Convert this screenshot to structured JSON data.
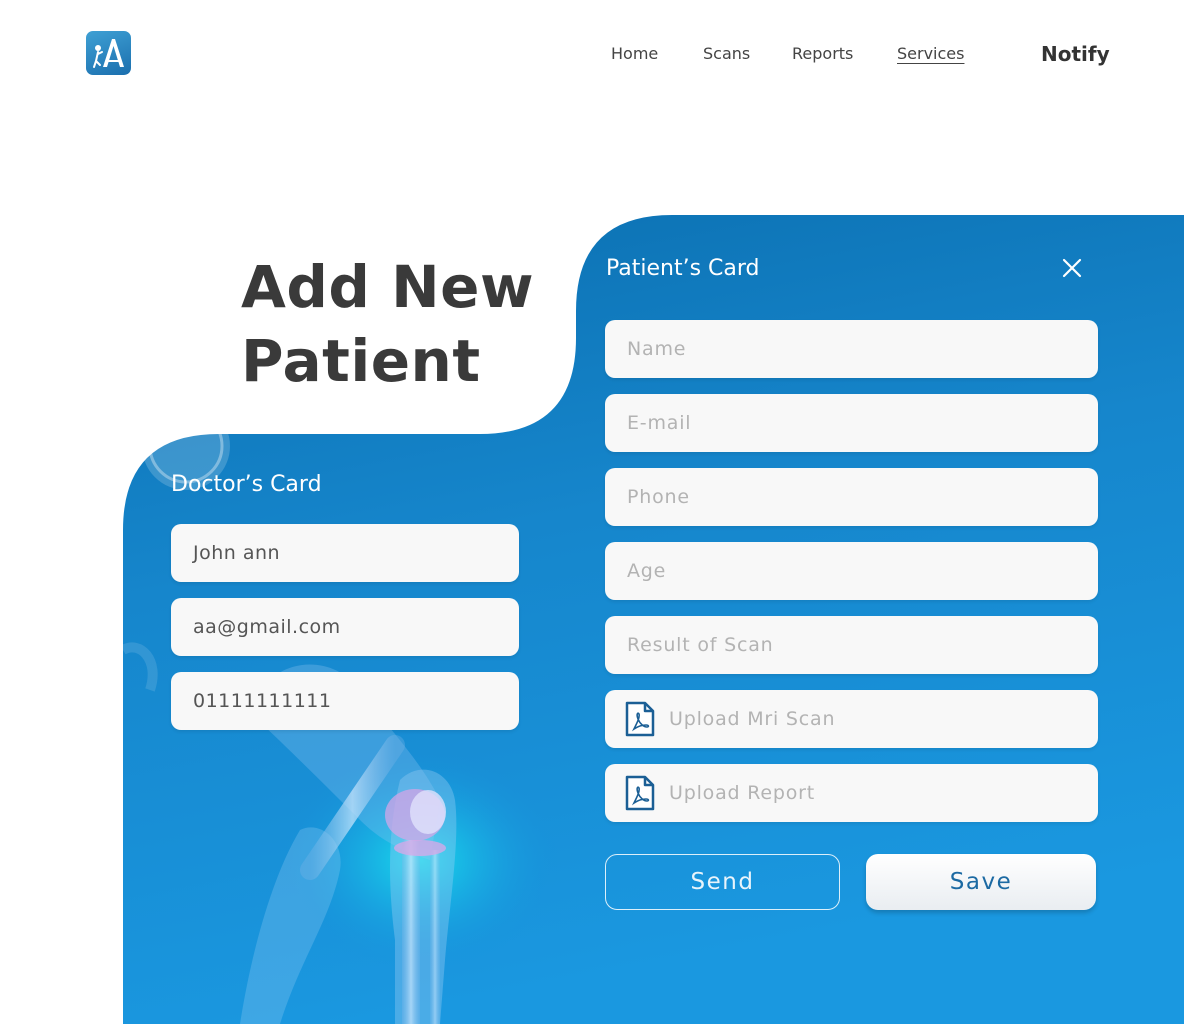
{
  "header": {
    "nav": [
      "Home",
      "Scans",
      "Reports",
      "Services"
    ],
    "notify_label": "Notify"
  },
  "page": {
    "title_line1": "Add New",
    "title_line2": "Patient"
  },
  "doctor_card": {
    "title": "Doctor’s Card",
    "name": "John ann",
    "email": "aa@gmail.com",
    "phone": "01111111111"
  },
  "patient_card": {
    "title": "Patient’s Card",
    "name_placeholder": "Name",
    "email_placeholder": "E-mail",
    "phone_placeholder": "Phone",
    "age_placeholder": "Age",
    "result_placeholder": "Result of Scan",
    "upload_mri_label": "Upload Mri Scan",
    "upload_report_label": "Upload Report",
    "send_label": "Send",
    "save_label": "Save"
  },
  "colors": {
    "brand_blue": "#1b7fc4",
    "title_gray": "#3a3a3a",
    "placeholder_gray": "#b3b3b3",
    "accent_cyan": "#17d3e8",
    "knee_pink": "#e8a6e8"
  },
  "icons": [
    "app-logo-icon",
    "close-icon",
    "pdf-file-icon"
  ]
}
